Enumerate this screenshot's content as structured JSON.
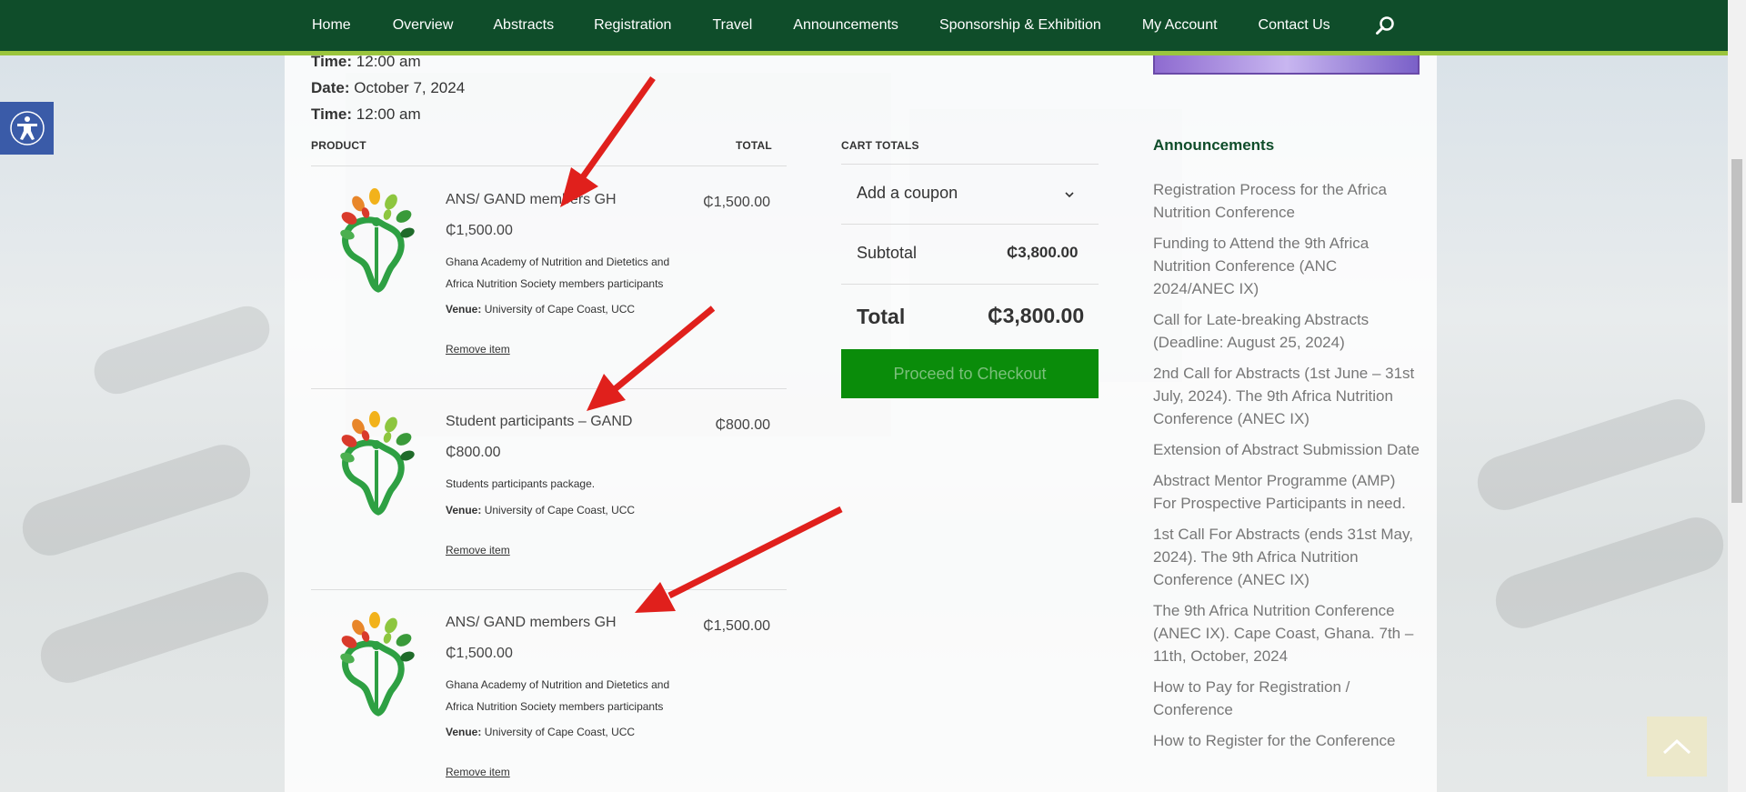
{
  "nav": {
    "items": [
      "Home",
      "Overview",
      "Abstracts",
      "Registration",
      "Travel",
      "Announcements",
      "Sponsorship & Exhibition",
      "My Account",
      "Contact Us"
    ]
  },
  "meta": {
    "time_label": "Time:",
    "time_value": "12:00 am",
    "date_label": "Date:",
    "date_value": "October 7, 2024",
    "time2_label": "Time:",
    "time2_value": "12:00 am"
  },
  "table": {
    "col_product": "PRODUCT",
    "col_total": "TOTAL"
  },
  "items": [
    {
      "name": "ANS/ GAND members GH",
      "price": "₵1,500.00",
      "desc": "Ghana Academy of Nutrition and Dietetics and Africa Nutrition Society members participants",
      "venue_label": "Venue:",
      "venue": "University of Cape Coast, UCC",
      "remove": "Remove item",
      "total": "₵1,500.00"
    },
    {
      "name": "Student participants – GAND",
      "price": "₵800.00",
      "desc": "Students participants package.",
      "venue_label": "Venue:",
      "venue": "University of Cape Coast, UCC",
      "remove": "Remove item",
      "total": "₵800.00"
    },
    {
      "name": "ANS/ GAND members GH",
      "price": "₵1,500.00",
      "desc": "Ghana Academy of Nutrition and Dietetics and Africa Nutrition Society members participants",
      "venue_label": "Venue:",
      "venue": "University of Cape Coast, UCC",
      "remove": "Remove item",
      "total": "₵1,500.00"
    }
  ],
  "cart": {
    "title": "CART TOTALS",
    "coupon": "Add a coupon",
    "subtotal_label": "Subtotal",
    "subtotal_value": "₵3,800.00",
    "total_label": "Total",
    "total_value": "₵3,800.00",
    "checkout": "Proceed to Checkout"
  },
  "sidebar": {
    "title": "Announcements",
    "items": [
      "Registration Process for the Africa Nutrition Conference",
      "Funding to Attend the 9th Africa Nutrition Conference (ANC 2024/ANEC IX)",
      "Call for Late-breaking Abstracts (Deadline: August 25, 2024)",
      "2nd Call for Abstracts (1st June – 31st July, 2024). The 9th Africa Nutrition Conference (ANEC IX)",
      "Extension of Abstract Submission Date",
      "Abstract Mentor Programme (AMP) For Prospective Participants in need.",
      "1st Call For Abstracts (ends 31st May, 2024). The 9th Africa Nutrition Conference (ANEC IX)",
      "The 9th Africa Nutrition Conference (ANEC IX). Cape Coast, Ghana. 7th – 11th, October, 2024",
      "How to Pay for Registration / Conference",
      "How to Register for the Conference"
    ]
  },
  "colors": {
    "nav_bg": "#0f4d2a",
    "nav_accent": "#9bc53d",
    "checkout_bg": "#0a8c0a",
    "accessibility_bg": "#3a5ba8",
    "arrow": "#e0201c"
  },
  "icons": [
    "search-icon",
    "accessibility-icon",
    "chevron-down-icon",
    "back-to-top-icon",
    "anc-logo"
  ]
}
